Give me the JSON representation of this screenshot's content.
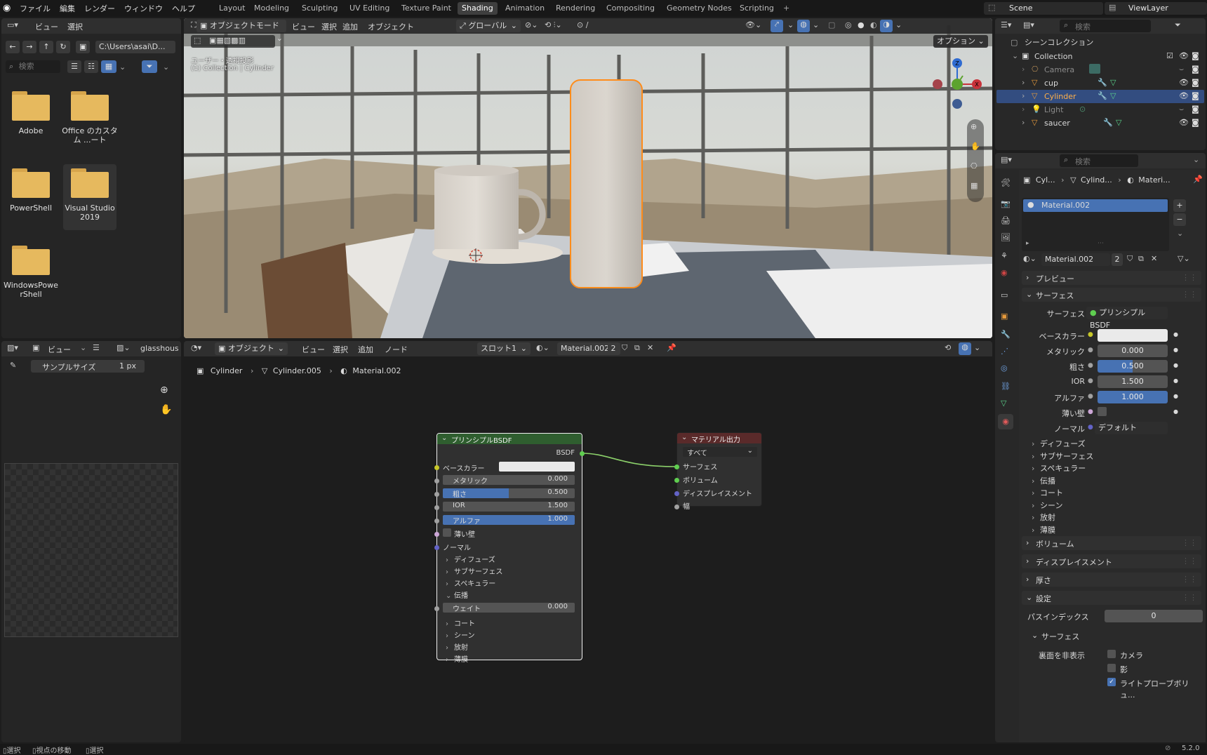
{
  "topbar": {
    "menus": [
      "ファイル",
      "編集",
      "レンダー",
      "ウィンドウ",
      "ヘルプ"
    ],
    "workspaces": [
      "Layout",
      "Modeling",
      "Sculpting",
      "UV Editing",
      "Texture Paint",
      "Shading",
      "Animation",
      "Rendering",
      "Compositing",
      "Geometry Nodes",
      "Scripting"
    ],
    "active_workspace": "Shading",
    "add_tab": "+",
    "scene": "Scene",
    "view_layer": "ViewLayer"
  },
  "filebrowser": {
    "menu": [
      "ビュー",
      "選択"
    ],
    "path": "C:\\Users\\asai\\D...",
    "search_placeholder": "検索",
    "folders": [
      {
        "name": "Adobe"
      },
      {
        "name": "Office のカスタム ...ート"
      },
      {
        "name": "PowerShell"
      },
      {
        "name": "Visual Studio 2019"
      },
      {
        "name": "WindowsPowerShell"
      }
    ]
  },
  "viewport": {
    "mode": "オブジェクトモード",
    "menu": [
      "ビュー",
      "選択",
      "追加",
      "オブジェクト"
    ],
    "transform": "グローバル",
    "overlay_line1": "ユーザー・透視投影",
    "overlay_line2": "(1) Collection | Cylinder",
    "options": "オプション",
    "gizmo": {
      "z": "Z",
      "x": "X"
    }
  },
  "imageeditor": {
    "view": "ビュー",
    "image_name": "glasshous",
    "sample_label": "サンプルサイズ",
    "sample_value": "1 px"
  },
  "nodeeditor": {
    "type": "オブジェクト",
    "menu": [
      "ビュー",
      "選択",
      "追加",
      "ノード"
    ],
    "slot": "スロット1",
    "material": "Material.002",
    "users": "2",
    "breadcrumb": [
      "Cylinder",
      "Cylinder.005",
      "Material.002"
    ],
    "bsdf": {
      "title": "プリンシプルBSDF",
      "output": "BSDF",
      "base_color": "ベースカラー",
      "metallic_label": "メタリック",
      "metallic": "0.000",
      "roughness_label": "粗さ",
      "roughness": "0.500",
      "ior_label": "IOR",
      "ior": "1.500",
      "alpha_label": "アルファ",
      "alpha": "1.000",
      "thin_wall": "薄い壁",
      "normal": "ノーマル",
      "diffuse": "ディフューズ",
      "subsurface": "サブサーフェス",
      "specular": "スペキュラー",
      "transmission": "伝播",
      "weight_label": "ウェイト",
      "weight": "0.000",
      "coat": "コート",
      "sheen": "シーン",
      "emission": "放射",
      "thin_film": "薄膜"
    },
    "output": {
      "title": "マテリアル出力",
      "target": "すべて",
      "surface": "サーフェス",
      "volume": "ボリューム",
      "displacement": "ディスプレイスメント",
      "thickness": "幅"
    }
  },
  "outliner": {
    "title": "シーンコレクション",
    "collection": "Collection",
    "items": [
      {
        "name": "Camera",
        "dim": true
      },
      {
        "name": "cup",
        "dim": false
      },
      {
        "name": "Cylinder",
        "dim": false,
        "selected": true
      },
      {
        "name": "Light",
        "dim": true
      },
      {
        "name": "saucer",
        "dim": false
      }
    ],
    "search_placeholder": "検索"
  },
  "properties": {
    "search_placeholder": "検索",
    "breadcrumb": [
      "Cyl...",
      "Cylind...",
      "Materi..."
    ],
    "slot": "Material.002",
    "material": "Material.002",
    "users": "2",
    "preview": "プレビュー",
    "surface_panel": "サーフェス",
    "surface_label": "サーフェス",
    "surface_value": "プリンシプルBSDF",
    "base_color_label": "ベースカラー",
    "metallic_label": "メタリック",
    "metallic": "0.000",
    "roughness_label": "粗さ",
    "roughness": "0.500",
    "ior_label": "IOR",
    "ior": "1.500",
    "alpha_label": "アルファ",
    "alpha": "1.000",
    "thin_wall_label": "薄い壁",
    "normal_label": "ノーマル",
    "normal_value": "デフォルト",
    "subs": [
      "ディフューズ",
      "サブサーフェス",
      "スペキュラー",
      "伝播",
      "コート",
      "シーン",
      "放射",
      "薄膜"
    ],
    "volume": "ボリューム",
    "displacement": "ディスプレイスメント",
    "thickness": "厚さ",
    "settings": "設定",
    "pass_index_label": "パスインデックス",
    "pass_index": "0",
    "settings_surface": "サーフェス",
    "backface_label": "裏面を非表示",
    "camera": "カメラ",
    "shadow": "影",
    "light_probe": "ライトプローブボリュ..."
  },
  "statusbar": {
    "items": [
      "選択",
      "視点の移動",
      "選択"
    ],
    "version": "5.2.0"
  },
  "colors": {
    "accent": "#4772b3",
    "selection": "#ff8c1a",
    "node_header": "#2f5e2f",
    "output_header": "#5a2a2a"
  }
}
